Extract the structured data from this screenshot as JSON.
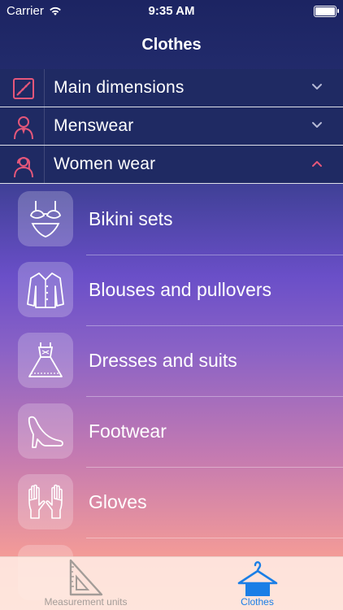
{
  "status_bar": {
    "carrier": "Carrier",
    "time": "9:35 AM"
  },
  "navbar": {
    "title": "Clothes"
  },
  "sections": [
    {
      "label": "Main dimensions",
      "icon": "ruler-pencil-icon",
      "expanded": false
    },
    {
      "label": "Menswear",
      "icon": "man-icon",
      "expanded": false
    },
    {
      "label": "Women wear",
      "icon": "woman-icon",
      "expanded": true
    }
  ],
  "women_items": [
    {
      "label": "Bikini sets",
      "icon": "bikini-icon"
    },
    {
      "label": "Blouses and pullovers",
      "icon": "blouse-icon"
    },
    {
      "label": "Dresses and suits",
      "icon": "dress-icon"
    },
    {
      "label": "Footwear",
      "icon": "high-heel-icon"
    },
    {
      "label": "Gloves",
      "icon": "gloves-icon"
    }
  ],
  "tabbar": {
    "tabs": [
      {
        "label": "Measurement units",
        "icon": "set-square-icon",
        "active": false
      },
      {
        "label": "Clothes",
        "icon": "hanger-icon",
        "active": true
      }
    ]
  },
  "colors": {
    "accent_active": "#1a7ee6",
    "chevron_open": "#e5577a",
    "icon_red": "#e5577a"
  }
}
